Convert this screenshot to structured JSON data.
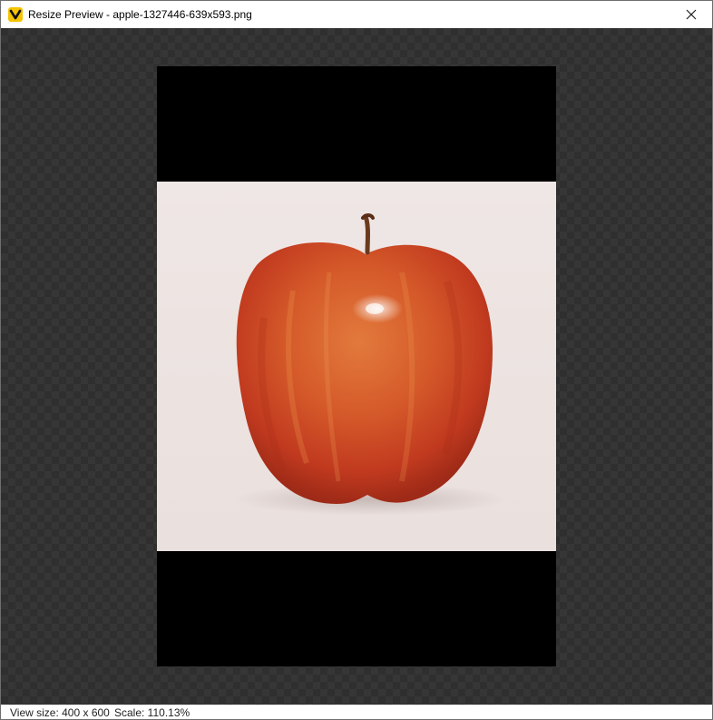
{
  "window": {
    "title": "Resize Preview - apple-1327446-639x593.png",
    "app_icon": "viewer-logo-icon",
    "close_icon": "close-icon"
  },
  "preview": {
    "image_subject": "red-apple-photo",
    "letterbox_color": "#000000",
    "background_color": "#2f2f2f",
    "image_background_color": "#eee6e4"
  },
  "status": {
    "view_size": "View size: 400 x 600",
    "scale": "Scale: 110.13%"
  },
  "colors": {
    "accent": "#f5c400",
    "apple_red": "#c6391f",
    "apple_orange": "#e0702f"
  }
}
